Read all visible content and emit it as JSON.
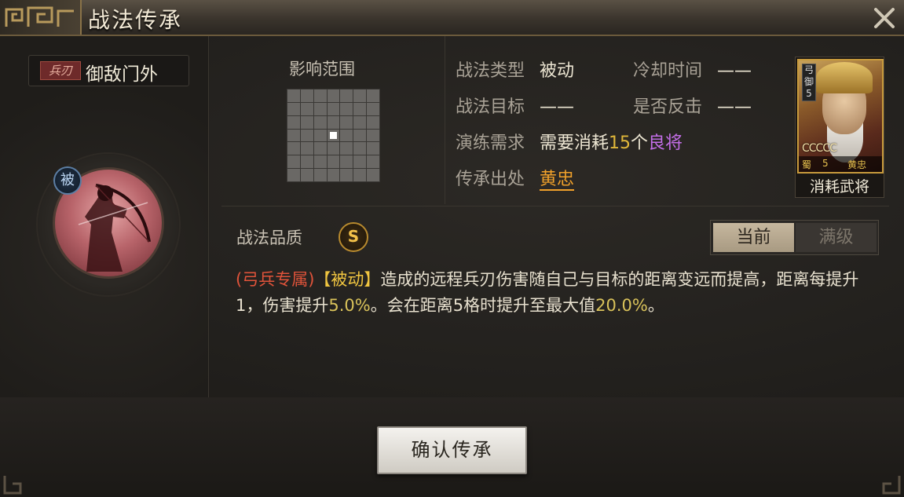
{
  "window": {
    "title": "战法传承"
  },
  "skill": {
    "tag": "兵刃",
    "name": "御敌门外",
    "passive_badge": "被"
  },
  "range": {
    "label": "影响范围"
  },
  "info": {
    "type_label": "战法类型",
    "type_value": "被动",
    "cooldown_label": "冷却时间",
    "cooldown_value": "——",
    "target_label": "战法目标",
    "target_value": "——",
    "counter_label": "是否反击",
    "counter_value": "——",
    "requirement_label": "演练需求",
    "requirement_prefix": "需要消耗",
    "requirement_count": "15",
    "requirement_unit": "个",
    "requirement_rank": "良将",
    "source_label": "传承出处",
    "source_value": "黄忠"
  },
  "card": {
    "unit_icon": "弓",
    "unit_text": "御",
    "unit_num": "5",
    "stars": "CCCCC",
    "faction": "蜀",
    "cost": "5",
    "name": "黄忠",
    "label": "消耗武将"
  },
  "quality": {
    "label": "战法品质",
    "grade": "S"
  },
  "toggle": {
    "current": "当前",
    "max": "满级"
  },
  "description": {
    "tag": "(弓兵专属)",
    "kind": "【被动】",
    "part1": "造成的远程兵刃伤害随自己与目标的距离变远而提高，距离每提升1，伤害提升",
    "value1": "5.0%",
    "part2": "。会在距离5格时提升至最大值",
    "value2": "20.0%",
    "part3": "。"
  },
  "actions": {
    "confirm": "确认传承"
  },
  "colors": {
    "gold": "#e0b73a",
    "purple": "#c46ee8",
    "orange": "#f1a12a",
    "red": "#e0533a"
  }
}
